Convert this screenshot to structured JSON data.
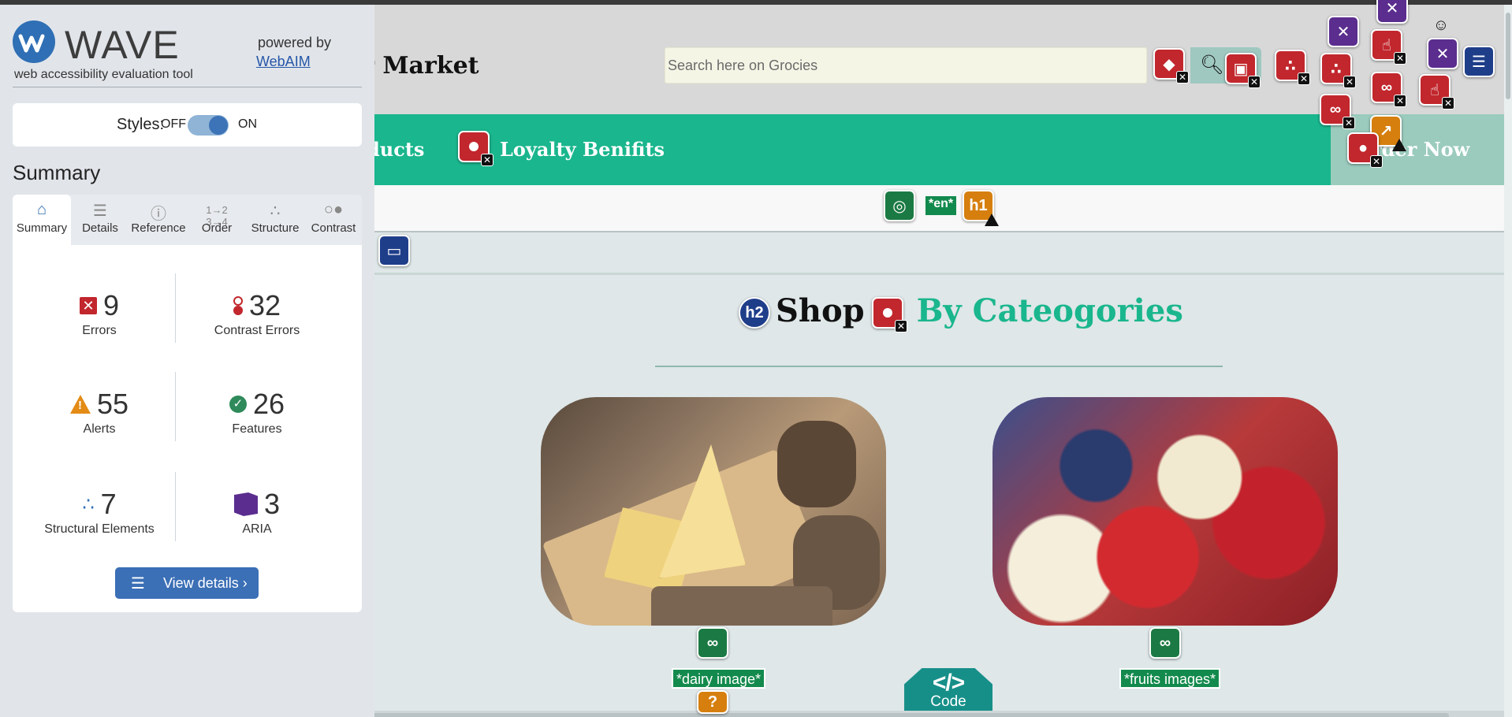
{
  "site": {
    "brand_fragment": "er Market",
    "search_placeholder": "Search here on Grocies",
    "nav": {
      "products_fragment": "ducts",
      "loyalty": "Loyalty Benifits",
      "order_now_fragment": "rder Now"
    },
    "lang_tag": "*en*",
    "heading_word1": "Shop",
    "heading_word2": "By Cateogories",
    "categories": [
      {
        "alt_label": "*dairy image*"
      },
      {
        "alt_label": "*fruits images*"
      }
    ],
    "code_tab_symbol": "</>",
    "code_tab_label": "Code"
  },
  "wave": {
    "title": "WAVE",
    "subtitle": "web accessibility evaluation tool",
    "powered_by": "powered by",
    "webaim": "WebAIM",
    "styles_label": "Styles:",
    "styles_off": "OFF",
    "styles_on": "ON",
    "summary_title": "Summary",
    "tabs": [
      {
        "label": "Summary",
        "icon": "home-icon",
        "active": true
      },
      {
        "label": "Details",
        "icon": "list-icon"
      },
      {
        "label": "Reference",
        "icon": "info-icon"
      },
      {
        "label": "Order",
        "icon": "order-icon"
      },
      {
        "label": "Structure",
        "icon": "structure-icon"
      },
      {
        "label": "Contrast",
        "icon": "contrast-icon"
      }
    ],
    "stats": {
      "errors": {
        "count": "9",
        "label": "Errors"
      },
      "contrast_errors": {
        "count": "32",
        "label": "Contrast Errors"
      },
      "alerts": {
        "count": "55",
        "label": "Alerts"
      },
      "features": {
        "count": "26",
        "label": "Features"
      },
      "structural": {
        "count": "7",
        "label": "Structural Elements"
      },
      "aria": {
        "count": "3",
        "label": "ARIA"
      }
    },
    "view_details": "View details ›"
  },
  "icon_glyphs": {
    "h1": "h1",
    "h2": "h2"
  },
  "colors": {
    "nav_green": "#1ab68d",
    "error_red": "#c1272d",
    "alert_orange": "#d67f0e",
    "feature_green": "#1b7a43",
    "structure_blue": "#1f3e8a",
    "aria_purple": "#5b2d8e",
    "wave_blue": "#3b6fb6"
  }
}
